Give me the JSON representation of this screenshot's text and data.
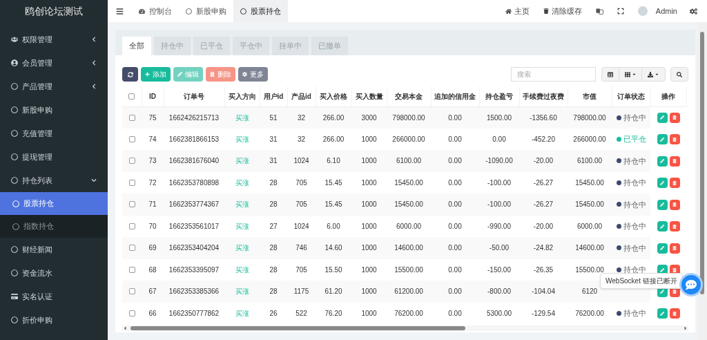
{
  "sidebar": {
    "title": "鸥创论坛测试",
    "items": [
      {
        "label": "权限管理",
        "kind": "users",
        "expanded": false
      },
      {
        "label": "会员管理",
        "kind": "user",
        "expanded": false
      },
      {
        "label": "产品管理",
        "kind": "circle",
        "expanded": false
      },
      {
        "label": "新股申购",
        "kind": "circle"
      },
      {
        "label": "充值管理",
        "kind": "circle"
      },
      {
        "label": "提现管理",
        "kind": "circle"
      },
      {
        "label": "持仓列表",
        "kind": "circle",
        "expanded": true,
        "children": [
          {
            "label": "股票持仓",
            "selected": true
          },
          {
            "label": "指数持仓",
            "selected": false
          }
        ]
      },
      {
        "label": "财经新闻",
        "kind": "circle"
      },
      {
        "label": "资金流水",
        "kind": "circle"
      },
      {
        "label": "实名认证",
        "kind": "card"
      },
      {
        "label": "折价申购",
        "kind": "circle"
      }
    ]
  },
  "top_tabs": [
    {
      "label": "控制台",
      "kind": "dashboard",
      "selected": false
    },
    {
      "label": "新股申购",
      "kind": "circle",
      "selected": false
    },
    {
      "label": "股票持仓",
      "kind": "circle",
      "selected": true
    }
  ],
  "top_right": {
    "home": "主页",
    "clear_cache": "清除缓存",
    "user": "Admin"
  },
  "filter_tabs": [
    {
      "label": "全部",
      "selected": true
    },
    {
      "label": "持仓中",
      "selected": false
    },
    {
      "label": "已平仓",
      "selected": false
    },
    {
      "label": "平仓中",
      "selected": false
    },
    {
      "label": "挂单中",
      "selected": false
    },
    {
      "label": "已撤单",
      "selected": false
    }
  ],
  "toolbar": {
    "add": "添加",
    "edit": "编辑",
    "delete": "删除",
    "more": "更多",
    "search_placeholder": "搜索"
  },
  "table": {
    "all_checked": false,
    "columns": [
      "ID",
      "订单号",
      "买入方向",
      "用户id",
      "产品id",
      "买入价格",
      "买入数量",
      "交易本金",
      "追加的信用金",
      "持仓盈亏",
      "手续费过夜费",
      "市值",
      "订单状态",
      "操作"
    ],
    "rows": [
      {
        "checked": false,
        "cells": [
          "75",
          "1662426215713",
          "买涨",
          "51",
          "32",
          "266.00",
          "3000",
          "798000.00",
          "0.00",
          "1500.00",
          "-1356.60",
          "798000.00"
        ],
        "status": {
          "label": "持仓中",
          "kind": "holding",
          "color": "#3c4a6e"
        }
      },
      {
        "checked": false,
        "cells": [
          "74",
          "1662381866153",
          "买涨",
          "31",
          "32",
          "266.00",
          "1000",
          "266000.00",
          "0.00",
          "0.00",
          "-452.20",
          "266000.00"
        ],
        "status": {
          "label": "已平仓",
          "kind": "closed",
          "color": "#1abc9c"
        }
      },
      {
        "checked": false,
        "cells": [
          "73",
          "1662381676040",
          "买涨",
          "31",
          "1024",
          "6.10",
          "1000",
          "6100.00",
          "0.00",
          "-1090.00",
          "-20.00",
          "6100.00"
        ],
        "status": {
          "label": "持仓中",
          "kind": "holding",
          "color": "#3c4a6e"
        }
      },
      {
        "checked": false,
        "cells": [
          "72",
          "1662353780898",
          "买涨",
          "28",
          "705",
          "15.45",
          "1000",
          "15450.00",
          "0.00",
          "-100.00",
          "-26.27",
          "15450.00"
        ],
        "status": {
          "label": "持仓中",
          "kind": "holding",
          "color": "#3c4a6e"
        }
      },
      {
        "checked": false,
        "cells": [
          "71",
          "1662353774367",
          "买涨",
          "28",
          "705",
          "15.45",
          "1000",
          "15450.00",
          "0.00",
          "-100.00",
          "-26.27",
          "15450.00"
        ],
        "status": {
          "label": "持仓中",
          "kind": "holding",
          "color": "#3c4a6e"
        }
      },
      {
        "checked": false,
        "cells": [
          "70",
          "1662353561017",
          "买涨",
          "27",
          "1024",
          "6.00",
          "1000",
          "6000.00",
          "0.00",
          "-990.00",
          "-20.00",
          "6000.00"
        ],
        "status": {
          "label": "持仓中",
          "kind": "holding",
          "color": "#3c4a6e"
        }
      },
      {
        "checked": false,
        "cells": [
          "69",
          "1662353404204",
          "买涨",
          "28",
          "746",
          "14.60",
          "1000",
          "14600.00",
          "0.00",
          "-50.00",
          "-24.82",
          "14600.00"
        ],
        "status": {
          "label": "持仓中",
          "kind": "holding",
          "color": "#3c4a6e"
        }
      },
      {
        "checked": false,
        "cells": [
          "68",
          "1662353395097",
          "买涨",
          "28",
          "705",
          "15.50",
          "1000",
          "15500.00",
          "0.00",
          "-150.00",
          "-26.35",
          "15500.00"
        ],
        "status": {
          "label": "持仓中",
          "kind": "holding",
          "color": "#3c4a6e"
        }
      },
      {
        "checked": false,
        "cells": [
          "67",
          "1662353385366",
          "买涨",
          "28",
          "1175",
          "61.20",
          "1000",
          "61200.00",
          "0.00",
          "-800.00",
          "-104.04",
          "6120"
        ]
      },
      {
        "checked": false,
        "cells": [
          "66",
          "1662350777862",
          "买涨",
          "26",
          "522",
          "76.20",
          "1000",
          "76200.00",
          "0.00",
          "5300.00",
          "-129.54",
          "76200.00"
        ],
        "status": {
          "label": "持仓中",
          "kind": "holding",
          "color": "#3c4a6e"
        }
      }
    ]
  },
  "toast": "WebSocket 链接已断开"
}
